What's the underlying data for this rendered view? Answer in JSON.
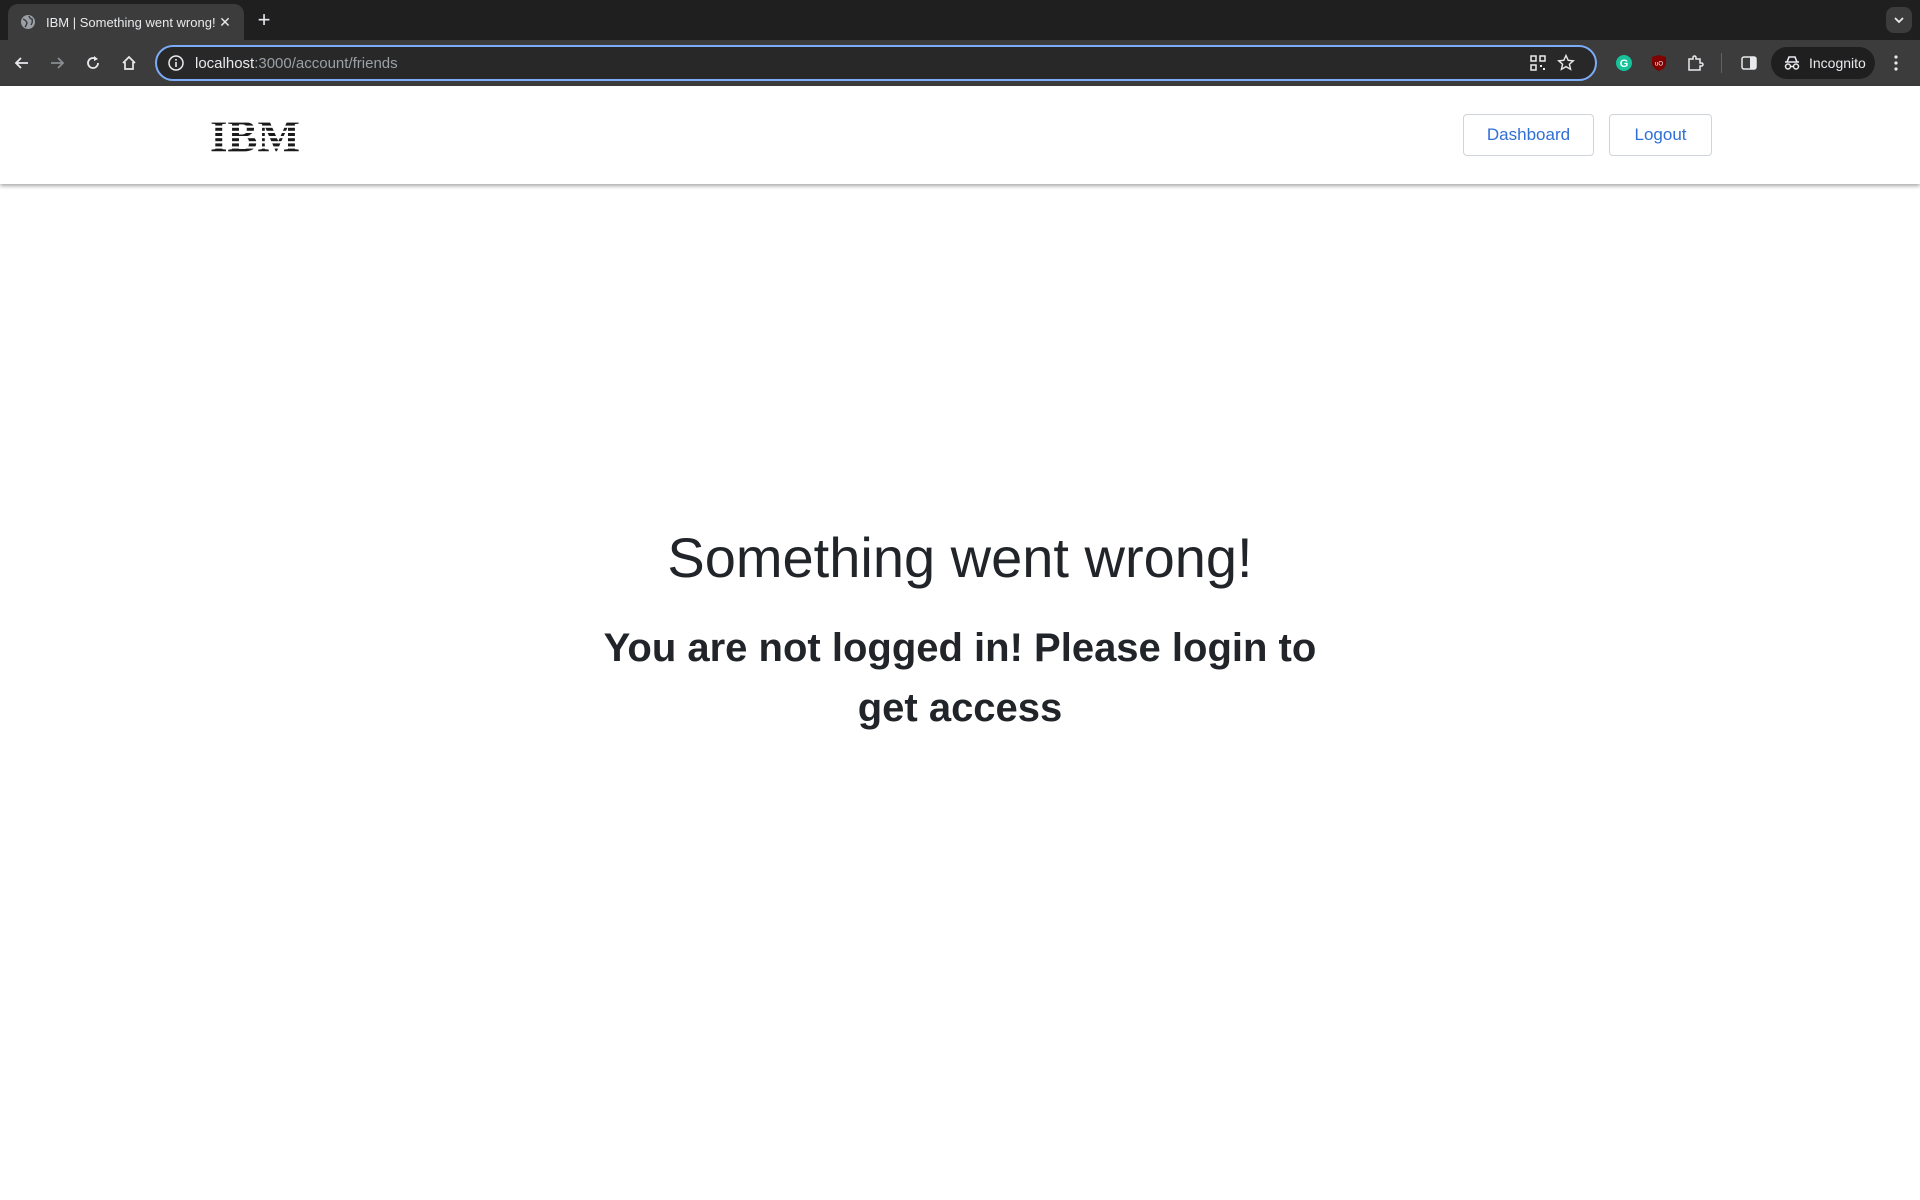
{
  "browser": {
    "tab_title": "IBM | Something went wrong!",
    "tab_close_icon": "close-icon",
    "new_tab_icon": "plus-icon",
    "url_host": "localhost",
    "url_rest": ":3000/account/friends",
    "incognito_label": "Incognito"
  },
  "header": {
    "logo_text": "IBM",
    "dashboard_label": "Dashboard",
    "logout_label": "Logout"
  },
  "main": {
    "title": "Something went wrong!",
    "message": "You are not logged in! Please login to get access"
  },
  "colors": {
    "accent": "#2f6fd6",
    "text": "#212529",
    "chrome_dark": "#1f1f1f",
    "chrome_toolbar": "#3c3c3c",
    "omnibox_focus": "#7cacf8"
  }
}
